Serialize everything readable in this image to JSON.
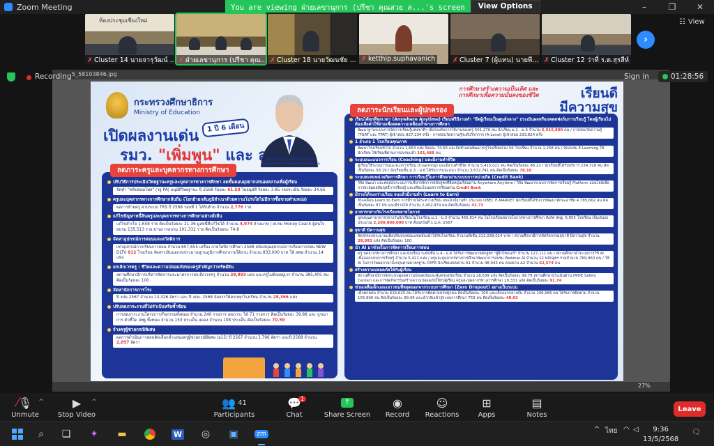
{
  "window": {
    "title": "Zoom Meeting",
    "share_banner": "You are viewing ฝ่ายเลขานุการ (ปรีชา คุณสวย ส...'s screen",
    "view_options": "View Options"
  },
  "gallery": {
    "tiles": [
      {
        "caption": "Cluster 14 นายจารุวัฒน์ ...",
        "slide_text": "ห้องประชุมเชียงใหม่"
      },
      {
        "caption": "ฝ่ายเลขานุการ (ปรีชา คุณ...",
        "slide_text": ""
      },
      {
        "caption": "Cluster 18 นายวัฒนชัย ...",
        "slide_text": ""
      },
      {
        "caption": "ketthip.suphavanich",
        "slide_text": ""
      },
      {
        "caption": "Cluster 7 (ผู้แทน) นายพี...",
        "slide_text": ""
      },
      {
        "caption": "Cluster 12 ว่าที่ ร.ต.สุรสีห์ ...",
        "slide_text": ""
      }
    ],
    "view_label": "View"
  },
  "status": {
    "recording": "Recording",
    "sign_in": "Sign in",
    "timer": "01:28:56"
  },
  "viewer": {
    "file_name": "5_58103846.jpg",
    "zoom": "27%"
  },
  "infographic": {
    "ministry_th": "กระทรวงศึกษาธิการ",
    "ministry_en": "Ministry of Education",
    "headline_1": "เปิดผลงานเด่น",
    "headline_2a": "รมว.",
    "headline_2b": "\"เพิ่มพูน\"",
    "headline_2c": "และ สพฐ.",
    "year_badge": "1 ปี 6 เดือน",
    "minister_name": "พลตำรวจเอก เพิ่มพูน ชิดชอบ",
    "minister_role": "รัฐมนตรีว่าการกระทรวงศึกษาธิการ",
    "left_title": "ลดภาระครูและบุคลากรทางการศึกษา",
    "left_items": [
      {
        "h": "ปรับวิธีการประเมินวิทยฐานะครูและบุคลากรทางการศึกษา ลดขั้นตอนยุ่งยากเสนอผลงานเพื่อผู้เรียน",
        "b": "จัดทำ \"คลิปคอมโพส\" (วฐ PA) อนุมัติวิทยฐานะ ปี 2568 ร้อยละ",
        "v": "61.50",
        "b2": "ไม่อนุมัติ ร้อยละ 3.85 รอประเมิน ร้อยละ 34.65"
      },
      {
        "h": "ครูและบุคลากรทางการศึกษากลับถิ่น (โยกย้ายกลับภูมิลำเนาด้วยความโปร่งใสไม่มีการซื้อขายตำแหน่ง)",
        "b": "ผลการย้ายครู ผ่านระบบ TRS ปี 2568 รอบที่ 1 ได้รับย้าย จำนวน",
        "v": "2,776",
        "b2": "ราย"
      },
      {
        "h": "แก้ไขปัญหาหนี้สินครูและบุคลากรทางการศึกษาอย่างยั่งยืน",
        "b": "แก้ไขสำเร็จ 1,658 ราย คิดเป็นร้อยละ 21.36 มูลหนี้ที่แก้ไขได้ จำนวน",
        "v": "4,974",
        "b2": "ล้านบาท / อบรม Money Coach ผู้สนใจอบรม 135,513 ราย ผ่านการอบรม 101,332 ราย คิดเป็นร้อยละ 74.8"
      },
      {
        "h": "จัดหาอุปกรณ์การสอนและสวัสดิการ",
        "b": "เช่าอุปกรณ์การเรียนการสอน จำนวน 607,655 เครื่อง ภายในปีการศึกษา 2568 สนับสนุนอุปกรณ์การเรียนการสอน NEW DLTV",
        "v": "612",
        "b2": "โรงเรียน จัดสรรเงินนอกงบประมาณฐานภูมิการศึกษาภายใต้งาน จำนวน 833,000 บาท ให้ สพท.จำนวน 14 แห่ง"
      },
      {
        "h": "ยกเลิกเวรครู : ชีวิตและความปลอดภัยของครูสำคัญกว่าทรัพย์สิน",
        "b": "สถานศึกษามีการบริหารจัดการและมาตรการยกเลิกเวรครู จำนวน",
        "v": "28,893",
        "b2": "แห่ง และครูไม่ต้องอยู่เวร จำนวน 385,405 คน คิดเป็นร้อยละ 100"
      },
      {
        "h": "จัดหานักการภารโรง",
        "b": "ปี งปม.2567 จำนวน 13,326 อัตรา และ ปี งปม. 2568 จัดสรรให้ครบทุกโรงเรียน จำนวน",
        "v": "28,366",
        "b2": "แห่ง"
      },
      {
        "h": "ปรับลดภาระงานที่ไม่จำเป็นหรือซ้ำซ้อน",
        "b": "การลดภาระงานโครงการ/กิจกรรมทั้งหมด จำนวน 240 รายการ ลดภาระ ได้ 71 รายการ คิดเป็นร้อยละ 39.88 และ บูรณาการ ตัวชี้วัด สพฐ.ทั้งหมด จำนวน 153 ประเด็น ลดลง จำนวน 108 ประเด็น คิดเป็นร้อยละ",
        "v": "70.59",
        "b2": ""
      },
      {
        "h": "จ้างครูผู้ช่วยกรณีพิเศษ",
        "b": "ผลการดำเนินการสอบคัดเลือกตำแหน่งครูผู้ช่วยกรณีพิเศษ (อ15) ปี 2567 จำนวน 3,796 อัตรา และปี 2568 จำนวน",
        "v": "2,857",
        "b2": "อัตรา"
      }
    ],
    "data_note": "ข้อมูล ณ วันที่ 9 พฤษภาคม 2568",
    "right_sub": "การศึกษาสร้างความเป็นเลิศ และการศึกษาเพื่อความมั่นคงของชีวิต",
    "right_big_1": "เรียนดี",
    "right_big_2": "มีความสุข",
    "right_title": "ลดภาระนักเรียนและผู้ปกครอง",
    "right_items": [
      {
        "h": "เรียนได้ทุกที่ทุกเวลา (Anywhere Anytime) เรียนฟรีมีงานทำ \"ยึดผู้เรียนเป็นศูนย์กลาง\" ประเมินผลหรือแพลตฟอร์มการเรียนรู้ โดยผู้เรียนไม่ต้องเสียค่าใช้จ่ายเพื่อลดความเหลื่อมล้ำทางการศึกษา",
        "b": "พัฒนาฐานระบบการจัดการเรียนรู้แห่งชาติฯ เพื่อรองรับการใช้งานของครู 501,276 คน นักเรียน ม.1 - ม.6 จำนวน",
        "v": "5,615,800",
        "b2": "คน / การสอบวัดความรู้ (TGAT และ TPAT) ผู้เข้าสอบ 827,234 ครั้ง - การสอบวัดความรู้ระดับวิชาการ (A-Level) ผู้เข้าสอบ 233,824 ครั้ง"
      },
      {
        "h": "1 อำเภอ 1 โรงเรียนคุณภาพ",
        "b": "พัฒนาโรงเรียนทั่วไป จำนวน 1,663 แห่ง ร้อยละ 74.56 และจัดทำแผนพัฒนาครูโรงเรียนรวม 56 โรงเรียน จำนวน 1,258 คน / จัดอบรม E-Learning ให้นักเรียน ใช้เรียนที่ผ่านการอบรมแล้ว",
        "v": "101,488",
        "b2": "คน"
      },
      {
        "h": "ระบบแนะแนวการเรียน (Coaching) และมีงานทำชีวิต",
        "b": "ผู้เรียนใช้ระบบการแนะแนวการเรียน (Coaching) และมีงานทำชีวิต จำนวน 5,415,021 คน คิดเป็นร้อยละ 86.22 / นักเรียนที่ได้รับบริการ 234,728 คน คิดเป็นร้อยละ 58.19 / นักเรียนชั้น ม.3 - ม.6 ได้รับการแนะแนว จำนวน 3,672,741 คน คิดเป็นร้อยละ",
        "v": "78.10",
        "b2": ""
      },
      {
        "h": "ระบบสะสมหน่วยกิตการศึกษา การเรียนรู้ในการศึกษาผ่านระบบการหน่วยกิต (Credit Bank)",
        "b": "วิจัย พัฒนา และทดสอบระบบการบริหารจัดการหลักสูตรที่ยืดหยุ่นเรียนผ่าน Anywhere Anytime / วิจัย พัฒนาระบบการจัดการเรียนรู้ Platform ออนไลน์เพื่อการสะสมผลสัมฤทธิ์การเรียนรู้ และเทียบโอนผลการเรียนผ่าน",
        "v": "Credit Bank",
        "b2": ""
      },
      {
        "h": "มีรายได้ระหว่างเรียน จบแล้วมีงานทำ (Learn to Earn)",
        "b": "ขับเคลื่อน Learn to Earn การมีรายได้ระหว่างเรียน จบแล้วมีงานทำ ประกอบ OBEC E-MARKET นักเรียนที่ได้รับการพัฒนาทักษะอาชีพ 4,785,662 คน คิดเป็นร้อยละ 87.09 และมีรายได้ จำนวน 2,402,974 คน คิดเป็นร้อยละ",
        "v": "43.73",
        "b2": ""
      },
      {
        "h": "อาหารกลางวันโรงเรียนขยายโอกาส",
        "b": "อุดหนุนค่าอาหารกลางวันนักเรียนในโรงเรียน ม.1 - ม.3 จำนวน 455,814 คน ในโรงเรียนขยายโอกาสทางการศึกษา สังกัด สพฐ. 6,855 โรงเรียน เป็นเงินงบประมาณ",
        "v": "2,200,000,000",
        "b2": "บาท ตั้งแต่วันที่ 1 ม.ค. 2567"
      },
      {
        "h": "สุขาดี มีความสุข",
        "b": "จัดสรรงบประมาณเพื่อปรับปรุงซ่อมแซมห้องน้ำให้กับโรงเรียน จำนวนทั้งสิ้น 212,038,014 บาท / สถานศึกษามีการจัดกิจกรรมสุขาดี มีความสุข จำนวน",
        "v": "28,893",
        "b2": "แห่ง คิดเป็นร้อยละ 100"
      },
      {
        "h": "นำ AI มาช่วยในการจัดการเรียนการสอน",
        "b": "ครู บุคลากรทางการศึกษา และนักเรียน ระดับชั้น ม.4 - ม.6 ได้รับการพัฒนาหลักสูตร \"ผู้ฝึกไซเบอร์\" จำนวน 127,111 คน / สถานศึกษานำระบบการใช้ AI เพื่อออกแบบการเรียนรู้ จำนวน 5,421 แห่ง / ครูและบุคลากรทางการศึกษาพัฒนาการอบรม Webinar AI จำนวน 12 หลักสูตร รวมจำนวน 769,960 คน / ใช้ AI ในการวัดผลภาษาอังกฤษตามมาตรฐาน CEFR นักเรียนสอบผ่าน A1 จำนวน 48,943 คน สอบผ่าน A2 จำนวน",
        "v": "62,574",
        "b2": "คน"
      },
      {
        "h": "สร้างความปลอดภัยให้กับผู้เรียน",
        "b": "สถานศึกษามีการจัดระบบดูแลความปลอดภัยและคุ้มครองนักเรียน จำนวน 28,639 แห่ง คิดเป็นร้อยละ 99.78 สถานศึกษาประเมินผ่าน (MOE Safety Center) และการจัดกิจกรรมสร้างความปลอดภัยให้กับผู้เรียน ครูและบุคลากรทางการศึกษา 20,331 แห่ง คิดเป็นร้อยละ",
        "v": "91.74",
        "b2": ""
      },
      {
        "h": "ช่วยเหลือเด็กและเยาวชนที่หลุดออกจากระบบการศึกษา (Zero Dropout) อย่างเป็นระบบ",
        "b": "เด็กตกหล่น จำนวน 616,625 คน ได้รับการติดตามครบทุกคน คิดเป็นร้อยละ 100 และเด็กออกกลางคัน จำนวน 106,966 คน ได้รับการติดตาม จำนวน 105,996 คน คิดเป็นร้อยละ 99.09 และนำกลับเข้าสู่ระบบการศึกษา 753 คน คิดเป็นร้อยละ",
        "v": "48.02",
        "b2": ""
      }
    ]
  },
  "controls": {
    "unmute": "Unmute",
    "stop_video": "Stop Video",
    "participants": "Participants",
    "participant_count": "41",
    "chat": "Chat",
    "chat_badge": "1",
    "share_screen": "Share Screen",
    "record": "Record",
    "reactions": "Reactions",
    "apps": "Apps",
    "notes": "Notes",
    "leave": "Leave"
  },
  "taskbar": {
    "time": "9:36",
    "date": "13/5/2568",
    "lang": "ไทย"
  },
  "colors": {
    "zoom_blue": "#2d8cff",
    "share_green": "#24c659",
    "leave_red": "#e02b2b",
    "panel_navy": "#1c3596",
    "accent_red": "#e8423b"
  }
}
